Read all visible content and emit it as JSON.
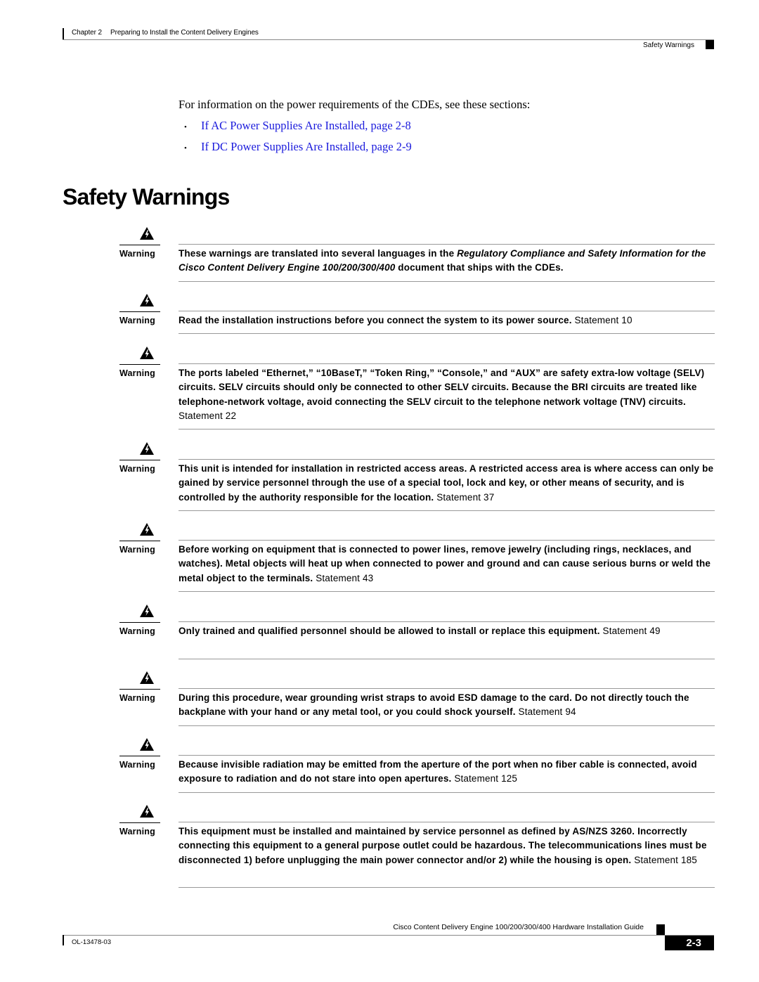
{
  "header": {
    "chapter_label": "Chapter 2",
    "chapter_title": "Preparing to Install the Content Delivery Engines",
    "section": "Safety Warnings"
  },
  "intro": {
    "text": "For information on the power requirements of the CDEs, see these sections:",
    "links": [
      {
        "label": "If AC Power Supplies Are Installed, page 2-8"
      },
      {
        "label": "If DC Power Supplies Are Installed, page 2-9"
      }
    ],
    "link_color": "#1a1adc"
  },
  "section_title": "Safety Warnings",
  "warnings": [
    {
      "label": "Warning",
      "parts": [
        {
          "t": "These warnings are translated into several languages in the ",
          "s": "b"
        },
        {
          "t": "Regulatory Compliance and Safety Information for the Cisco Content Delivery Engine 100/200/300/400",
          "s": "i"
        },
        {
          "t": " document that ships with the CDEs.",
          "s": "b"
        }
      ],
      "statement": ""
    },
    {
      "label": "Warning",
      "parts": [
        {
          "t": "Read the installation instructions before you connect the system to its power source.",
          "s": "b"
        }
      ],
      "statement": "Statement 10"
    },
    {
      "label": "Warning",
      "parts": [
        {
          "t": "The ports labeled “Ethernet,” “10BaseT,” “Token Ring,” “Console,” and “AUX” are safety extra-low voltage (SELV) circuits. SELV circuits should only be connected to other SELV circuits. Because the BRI circuits are treated like telephone-network voltage, avoid connecting the SELV circuit to the telephone network voltage (TNV) circuits.",
          "s": "b"
        }
      ],
      "statement": "Statement 22"
    },
    {
      "label": "Warning",
      "parts": [
        {
          "t": "This unit is intended for installation in restricted access areas. A restricted access area is where access can only be gained by service personnel through the use of a special tool, lock and key, or other means of security, and is controlled by the authority responsible for the location.",
          "s": "b"
        }
      ],
      "statement": "Statement 37"
    },
    {
      "label": "Warning",
      "parts": [
        {
          "t": "Before working on equipment that is connected to power lines, remove jewelry (including rings, necklaces, and watches). Metal objects will heat up when connected to power and ground and can cause serious burns or weld the metal object to the terminals.",
          "s": "b"
        }
      ],
      "statement": "Statement 43"
    },
    {
      "label": "Warning",
      "parts": [
        {
          "t": "Only trained and qualified personnel should be allowed to install or replace this equipment.",
          "s": "b"
        }
      ],
      "statement": "Statement 49"
    },
    {
      "label": "Warning",
      "parts": [
        {
          "t": "During this procedure, wear grounding wrist straps to avoid ESD damage to the card. Do not directly touch the backplane with your hand or any metal tool, or you could shock yourself.",
          "s": "b"
        }
      ],
      "statement": "Statement 94"
    },
    {
      "label": "Warning",
      "parts": [
        {
          "t": "Because invisible radiation may be emitted from the aperture of the port when no fiber cable is connected, avoid exposure to radiation and do not stare into open apertures.",
          "s": "b"
        }
      ],
      "statement": "Statement 125"
    },
    {
      "label": "Warning",
      "parts": [
        {
          "t": "This equipment must be installed and maintained by service personnel as defined by AS/NZS 3260. Incorrectly connecting this equipment to a general purpose outlet could be hazardous. The telecommunications lines must be disconnected 1) before unplugging the main power connector and/or 2) while the housing is open.",
          "s": "b"
        }
      ],
      "statement": "Statement 185"
    }
  ],
  "footer": {
    "guide_title": "Cisco Content Delivery Engine 100/200/300/400 Hardware Installation Guide",
    "doc_number": "OL-13478-03",
    "page": "2-3"
  }
}
